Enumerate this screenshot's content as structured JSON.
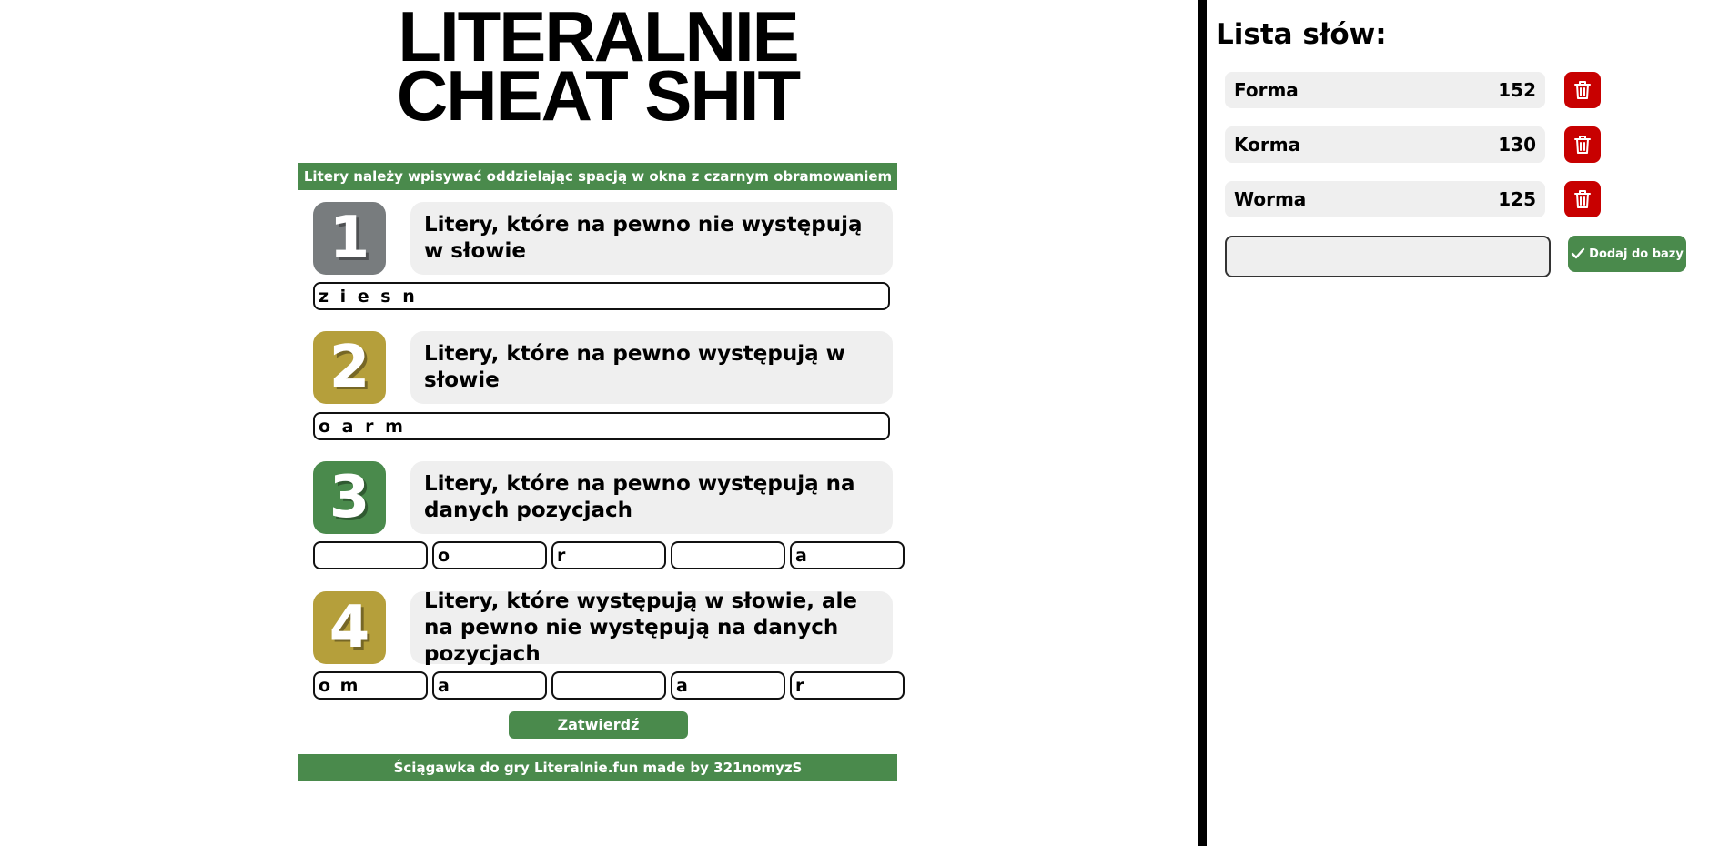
{
  "title": {
    "line1": "LITERALNIE",
    "line2": "CHEAT SHIT"
  },
  "instruction_banner": "Litery należy wpisywać oddzielając spacją w okna z czarnym obramowaniem",
  "sections": [
    {
      "number": "1",
      "color": "#787c7e",
      "label": "Litery, które na pewno nie występują w słowie",
      "value": "z i e s n"
    },
    {
      "number": "2",
      "color": "#b59f3b",
      "label": "Litery, które na pewno występują w słowie",
      "value": "o a r m"
    },
    {
      "number": "3",
      "color": "#4a8a4c",
      "label": "Litery, które na pewno występują na danych pozycjach",
      "cells": [
        "",
        "o",
        "r",
        "",
        "a"
      ]
    },
    {
      "number": "4",
      "color": "#b59f3b",
      "label": "Litery, które występują w słowie, ale na pewno nie występują na danych pozycjach",
      "cells": [
        "o m",
        "a",
        "",
        "a",
        "r"
      ]
    }
  ],
  "submit_label": "Zatwierdź",
  "footer": "Ściągawka do gry Literalnie.fun made by 321nomyzS",
  "word_list": {
    "title": "Lista słów:",
    "words": [
      {
        "word": "Forma",
        "score": "152"
      },
      {
        "word": "Korma",
        "score": "130"
      },
      {
        "word": "Worma",
        "score": "125"
      }
    ],
    "new_word_value": "",
    "add_label": "Dodaj do bazy",
    "delete_icon": "trash-icon",
    "add_icon": "check-icon"
  },
  "colors": {
    "green": "#4a8a4c",
    "gold": "#b59f3b",
    "gray": "#787c7e",
    "delete_red": "#c80000"
  }
}
